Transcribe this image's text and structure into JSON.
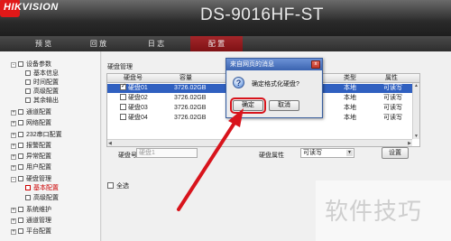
{
  "header": {
    "logo": "HIKVISION",
    "model": "DS-9016HF-ST"
  },
  "nav": {
    "tabs": [
      "预 览",
      "回 放",
      "日 志",
      "配 置"
    ],
    "active": "配 置"
  },
  "sidebar": {
    "items": [
      {
        "label": "设备参数",
        "level": 0,
        "expanded": true
      },
      {
        "label": "基本信息",
        "level": 1
      },
      {
        "label": "时间配置",
        "level": 1
      },
      {
        "label": "高级配置",
        "level": 1
      },
      {
        "label": "其余输出",
        "level": 1
      },
      {
        "label": "通道配置",
        "level": 0,
        "expanded": false
      },
      {
        "label": "网络配置",
        "level": 0,
        "expanded": false
      },
      {
        "label": "232串口配置",
        "level": 0,
        "expanded": false
      },
      {
        "label": "报警配置",
        "level": 0,
        "expanded": false
      },
      {
        "label": "异常配置",
        "level": 0,
        "expanded": false
      },
      {
        "label": "用户配置",
        "level": 0,
        "expanded": false
      },
      {
        "label": "硬盘管理",
        "level": 0,
        "expanded": true
      },
      {
        "label": "基本配置",
        "level": 1,
        "selected": true
      },
      {
        "label": "高级配置",
        "level": 1
      },
      {
        "label": "系统维护",
        "level": 0,
        "expanded": false
      },
      {
        "label": "通道管理",
        "level": 0,
        "expanded": false
      },
      {
        "label": "平台配置",
        "level": 0,
        "expanded": false
      }
    ]
  },
  "main": {
    "section_title": "硬盘管理",
    "columns": [
      "硬盘号",
      "容量",
      "",
      "",
      "",
      "类型",
      "属性"
    ],
    "rows": [
      {
        "id": "硬盘01",
        "capacity": "3726.02GB",
        "type": "本地",
        "attr": "可读写",
        "checked": true,
        "selected": true
      },
      {
        "id": "硬盘02",
        "capacity": "3726.02GB",
        "type": "本地",
        "attr": "可读写",
        "checked": false,
        "selected": false
      },
      {
        "id": "硬盘03",
        "capacity": "3726.02GB",
        "type": "本地",
        "attr": "可读写",
        "checked": false,
        "selected": false
      },
      {
        "id": "硬盘04",
        "capacity": "3726.02GB",
        "type": "本地",
        "attr": "可读写",
        "checked": false,
        "selected": false
      }
    ],
    "disk_no_label": "硬盘号",
    "disk_no_placeholder": "硬盘1",
    "disk_attr_label": "硬盘属性",
    "disk_attr_value": "可读写",
    "set_button": "设置",
    "select_all": "全选"
  },
  "dialog": {
    "title": "来自网页的消息",
    "message": "确定格式化硬盘?",
    "ok": "确定",
    "cancel": "取消",
    "close": "x"
  },
  "watermark": {
    "text": "软件技巧"
  },
  "colors": {
    "accent_red": "#d8141c",
    "nav_active": "#9a1e22",
    "selection_blue": "#3060c0"
  }
}
